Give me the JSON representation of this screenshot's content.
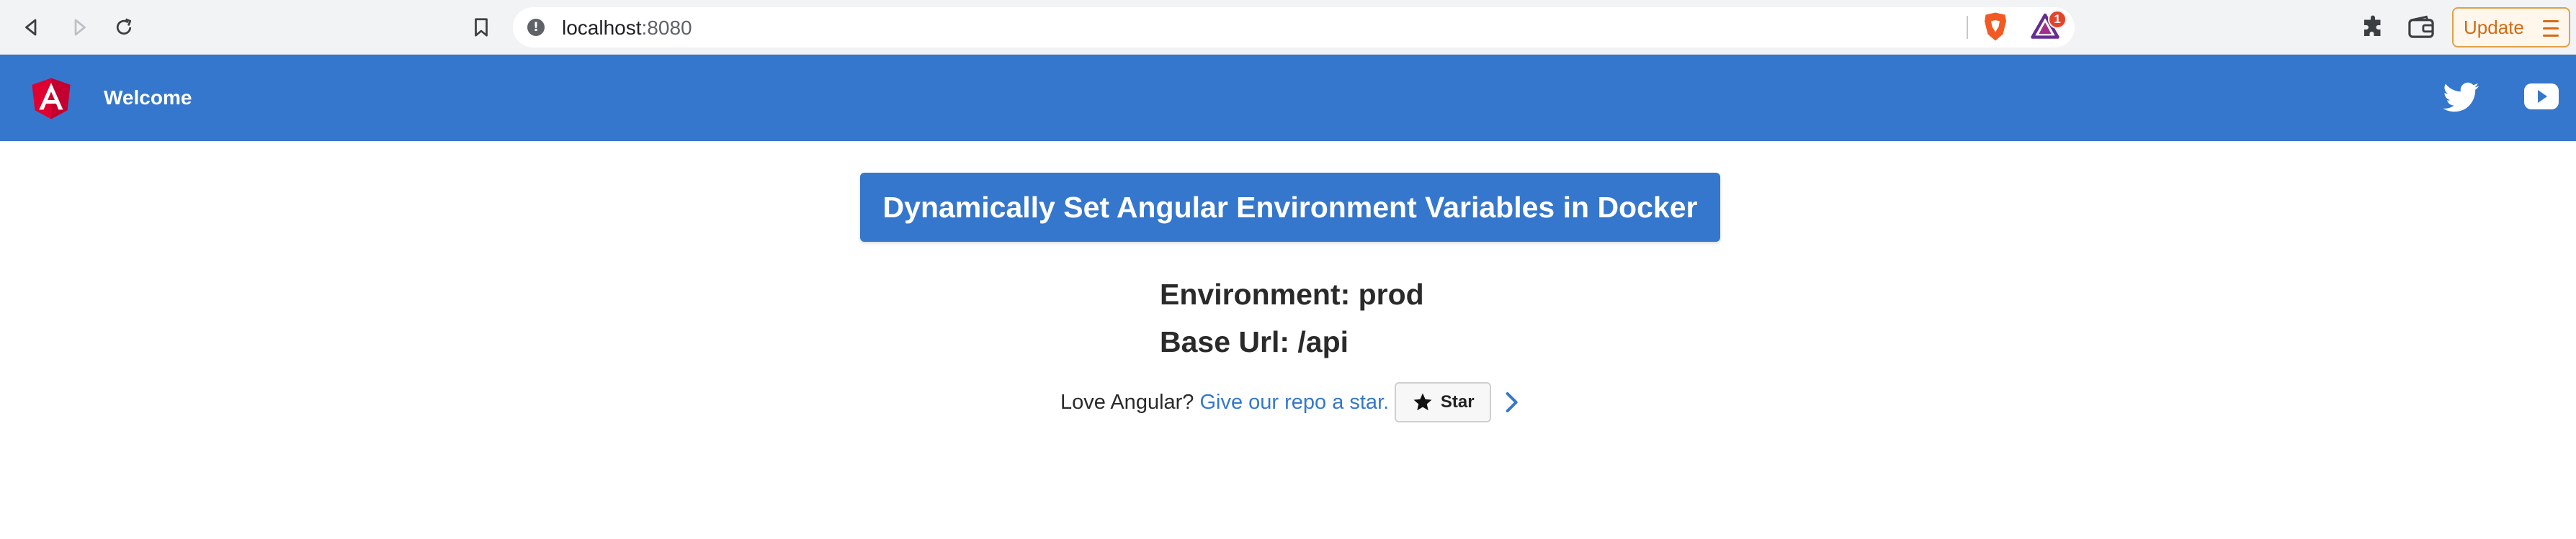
{
  "browser": {
    "url_host": "localhost",
    "url_port": ":8080",
    "rewards_badge_count": "1",
    "update_label": "Update"
  },
  "toolbar": {
    "title": "Welcome",
    "accent_color": "#3577cc"
  },
  "main": {
    "headline": "Dynamically Set Angular Environment Variables in Docker",
    "environment_line": "Environment: prod",
    "base_url_line": "Base Url: /api",
    "cta_prefix": "Love Angular?",
    "cta_link": "Give our repo a star.",
    "star_label": "Star"
  },
  "icons": [
    "back-icon",
    "forward-icon",
    "reload-icon",
    "bookmark-icon",
    "info-icon",
    "brave-shield-icon",
    "brave-rewards-icon",
    "extensions-icon",
    "wallet-icon",
    "menu-icon",
    "angular-logo",
    "twitter-icon",
    "youtube-icon",
    "star-icon",
    "chevron-right-icon"
  ]
}
